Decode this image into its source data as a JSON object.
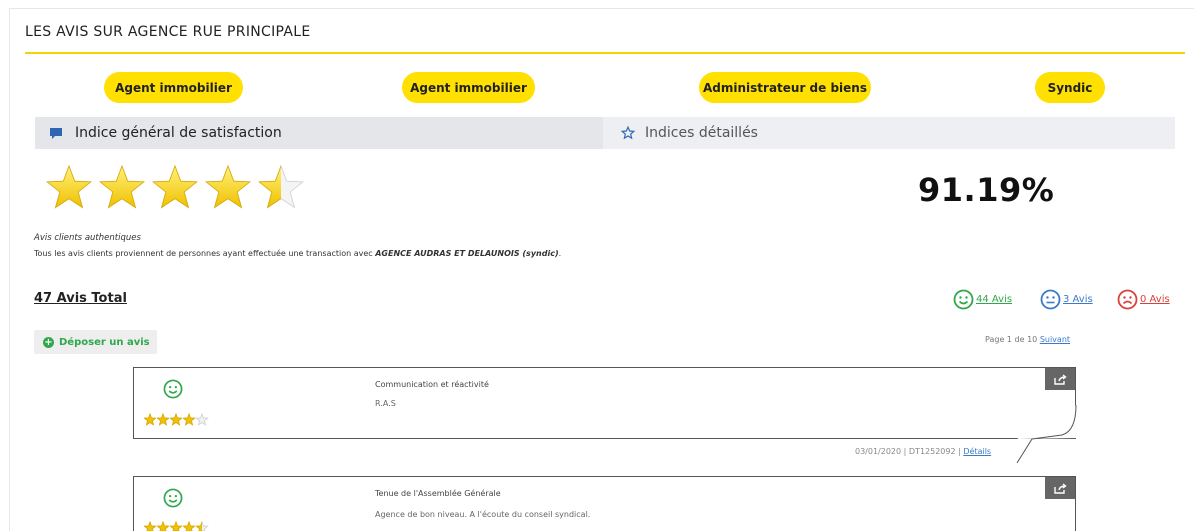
{
  "header": {
    "title": "LES AVIS SUR AGENCE RUE PRINCIPALE"
  },
  "categories": [
    "Agent immobilier",
    "Agent immobilier",
    "Administrateur de biens",
    "Syndic"
  ],
  "tabs": {
    "general": "Indice général de satisfaction",
    "detailed": "Indices détaillés"
  },
  "rating": {
    "percent": "91.19%",
    "stars": 4.5,
    "max": 5
  },
  "authentic": {
    "title": "Avis clients authentiques",
    "text": "Tous les avis clients proviennent de personnes ayant effectuée une transaction avec ",
    "company": "AGENCE AUDRAS ET DELAUNOIS (syndic)",
    "end": "."
  },
  "totals": {
    "total_label": "47 Avis Total",
    "positive": "44 Avis",
    "neutral": "3 Avis",
    "negative": "0 Avis"
  },
  "actions": {
    "deposit": "Déposer un avis"
  },
  "pager": {
    "text": "Page 1 de 10",
    "next": "Suivant"
  },
  "reviews": [
    {
      "title": "Communication et réactivité",
      "body": "R.A.S",
      "stars": 4,
      "date": "03/01/2020",
      "ref": "DT1252092",
      "details": "Détails"
    },
    {
      "title": "Tenue de l'Assemblée Générale",
      "body": "Agence de bon niveau. A l'écoute du conseil syndical.",
      "stars": 4.5
    }
  ],
  "colors": {
    "accent": "#ffe000",
    "positive": "#2ea84b",
    "neutral": "#3a7bc8",
    "negative": "#d9413a"
  },
  "icons": {
    "tab_general": "speech-bubble-icon",
    "tab_detailed": "star-outline-icon",
    "share": "share-icon"
  }
}
